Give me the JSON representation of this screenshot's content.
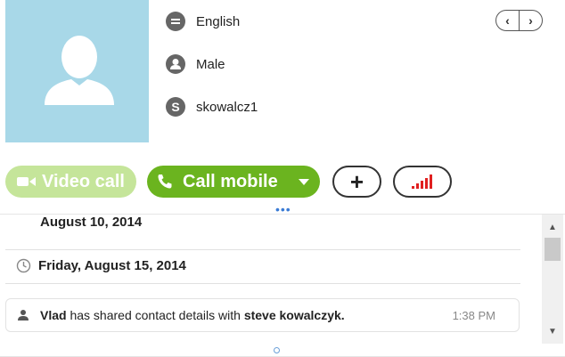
{
  "profile": {
    "language": "English",
    "gender": "Male",
    "skype_name": "skowalcz1"
  },
  "nav": {
    "prev": "‹",
    "next": "›"
  },
  "actions": {
    "video_call_label": "Video call",
    "call_mobile_label": "Call mobile",
    "add_label": "+"
  },
  "conversation": {
    "dates": [
      "August 10, 2014",
      "Friday, August 15, 2014"
    ],
    "message": {
      "sender": "Vlad",
      "action": "has shared contact details with",
      "recipient": "steve kowalczyk.",
      "time": "1:38 PM"
    }
  },
  "colors": {
    "avatar_bg": "#a8d8e8",
    "call_green": "#6bb41f",
    "video_green_disabled": "#c5e59a",
    "signal_red": "#e02020"
  },
  "icons": [
    "chat-bubble-icon",
    "person-icon",
    "skype-icon",
    "video-camera-icon",
    "phone-icon",
    "dropdown-arrow-icon",
    "signal-bars-icon",
    "clock-icon"
  ]
}
